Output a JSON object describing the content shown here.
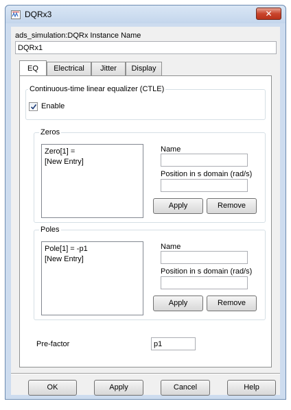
{
  "window": {
    "title": "DQRx3",
    "close_glyph": "✕"
  },
  "instance": {
    "label": "ads_simulation:DQRx Instance Name",
    "value": "DQRx1"
  },
  "tabs": [
    {
      "label": "EQ",
      "active": true
    },
    {
      "label": "Electrical",
      "active": false
    },
    {
      "label": "Jitter",
      "active": false
    },
    {
      "label": "Display",
      "active": false
    }
  ],
  "ctle": {
    "legend": "Continuous-time linear equalizer (CTLE)",
    "enable_label": "Enable",
    "enabled": true
  },
  "zeros": {
    "legend": "Zeros",
    "list": [
      "Zero[1] =",
      "[New Entry]"
    ],
    "name_label": "Name",
    "name_value": "",
    "position_label": "Position in s domain (rad/s)",
    "position_value": "",
    "apply_label": "Apply",
    "remove_label": "Remove"
  },
  "poles": {
    "legend": "Poles",
    "list": [
      "Pole[1] = -p1",
      "[New Entry]"
    ],
    "name_label": "Name",
    "name_value": "",
    "position_label": "Position in s domain (rad/s)",
    "position_value": "",
    "apply_label": "Apply",
    "remove_label": "Remove"
  },
  "prefactor": {
    "label": "Pre-factor",
    "value": "p1"
  },
  "footer": {
    "ok_label": "OK",
    "apply_label": "Apply",
    "cancel_label": "Cancel",
    "help_label": "Help"
  },
  "colors": {
    "window_frame": "#cddcef",
    "close_button": "#c9452c",
    "dialog_bg": "#f0f0f0"
  },
  "icons": {
    "app": "ads-schematic-icon",
    "close": "close-icon",
    "checkbox": "checkmark-icon"
  }
}
